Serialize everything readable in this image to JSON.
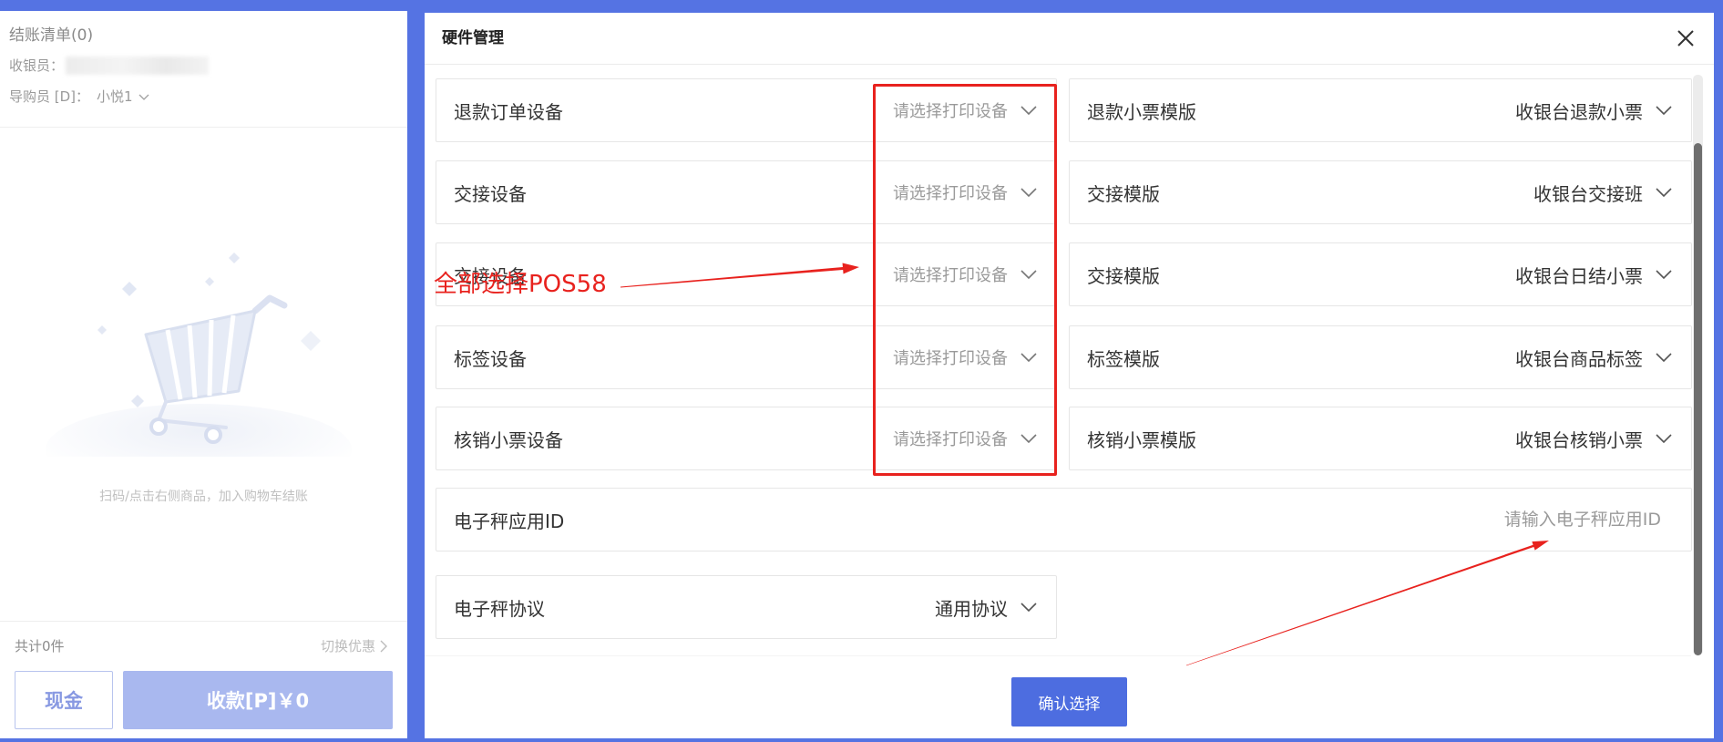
{
  "colors": {
    "background": "#5573e3",
    "primary": "#4d6de0",
    "annotation": "#e8221e"
  },
  "checkout": {
    "title": "结账清单(0)",
    "cashier_label": "收银员：",
    "guide_label": "导购员 [D]：",
    "guide_value": "小悦1",
    "empty_hint": "扫码/点击右侧商品，加入购物车结账",
    "total_label": "共计0件",
    "switch_discount": "切换优惠",
    "cash_button": "现金",
    "pay_button": "收款[P]￥0"
  },
  "hardware_modal": {
    "title": "硬件管理",
    "rows": [
      {
        "left": {
          "label": "退款订单设备",
          "placeholder": "请选择打印设备"
        },
        "right": {
          "label": "退款小票模版",
          "value": "收银台退款小票"
        }
      },
      {
        "left": {
          "label": "交接设备",
          "placeholder": "请选择打印设备"
        },
        "right": {
          "label": "交接模版",
          "value": "收银台交接班"
        }
      },
      {
        "left": {
          "label": "交接设备",
          "placeholder": "请选择打印设备"
        },
        "right": {
          "label": "交接模版",
          "value": "收银台日结小票"
        }
      },
      {
        "left": {
          "label": "标签设备",
          "placeholder": "请选择打印设备"
        },
        "right": {
          "label": "标签模版",
          "value": "收银台商品标签"
        }
      },
      {
        "left": {
          "label": "核销小票设备",
          "placeholder": "请选择打印设备"
        },
        "right": {
          "label": "核销小票模版",
          "value": "收银台核销小票"
        }
      }
    ],
    "scale_app_id": {
      "label": "电子秤应用ID",
      "placeholder": "请输入电子秤应用ID"
    },
    "scale_protocol": {
      "label": "电子秤协议",
      "value": "通用协议"
    },
    "confirm_button": "确认选择"
  },
  "annotation": {
    "note_text": "全部选择POS58"
  }
}
